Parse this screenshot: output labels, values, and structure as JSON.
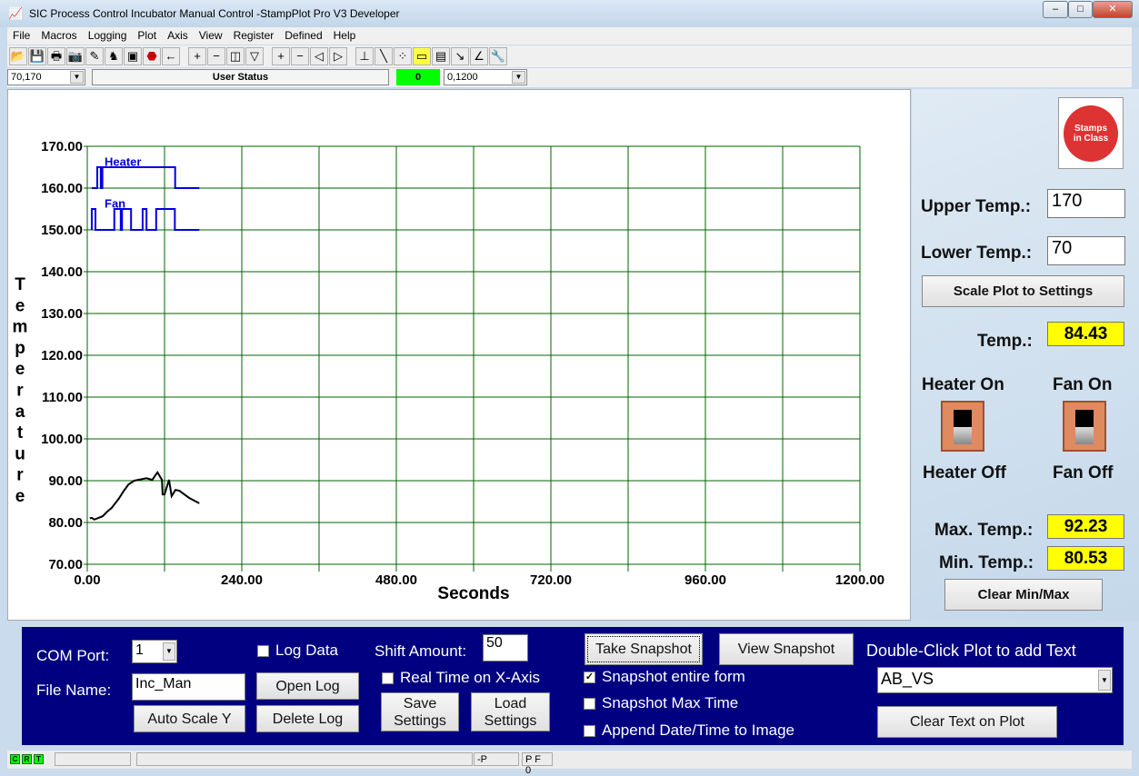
{
  "window": {
    "title": "SIC Process Control Incubator Manual Control -StampPlot Pro V3 Developer",
    "buttons": [
      "–",
      "□",
      "✕"
    ]
  },
  "menu": [
    "File",
    "Macros",
    "Logging",
    "Plot",
    "Axis",
    "View",
    "Register",
    "Defined",
    "Help"
  ],
  "toolbar": [
    "open-folder",
    "save",
    "print",
    "camera",
    "wand",
    "plot-dog",
    "screen",
    "stop",
    "back-arrow",
    "|",
    "plus",
    "minus",
    "zoom-box",
    "zoom-v",
    "|",
    "plus",
    "minus",
    "shift-left",
    "shift-right",
    "|",
    "axis",
    "pen",
    "scatter",
    "note",
    "clipboard",
    "probe",
    "angle",
    "wrench"
  ],
  "statusrow": {
    "y_range": "70,170",
    "user_status": "User Status",
    "counter": "0",
    "x_range": "0,1200",
    "counter_color": "#00ff00"
  },
  "chart_data": {
    "type": "line",
    "xlabel": "Seconds",
    "ylabel": "Temperature",
    "xlim": [
      0,
      1200
    ],
    "ylim": [
      70,
      170
    ],
    "xticks": [
      "0.00",
      "240.00",
      "480.00",
      "720.00",
      "960.00",
      "1200.00"
    ],
    "yticks": [
      "70.00",
      "80.00",
      "90.00",
      "100.00",
      "110.00",
      "120.00",
      "130.00",
      "140.00",
      "150.00",
      "160.00",
      "170.00"
    ],
    "grid": true,
    "grid_color": "#006400",
    "series": [
      {
        "name": "Heater",
        "color": "#0000e0",
        "x": [
          7,
          15.5,
          15.5,
          21,
          21,
          23.5,
          23.5,
          27,
          27,
          136.5,
          136.5,
          174
        ],
        "y": [
          160,
          160,
          165,
          165,
          160,
          160,
          165,
          165,
          165,
          165,
          160,
          160
        ]
      },
      {
        "name": "Fan",
        "color": "#0000e0",
        "x": [
          7,
          7,
          12.7,
          12.7,
          42,
          42,
          52,
          52,
          54,
          54,
          59,
          59,
          68,
          68,
          86,
          86,
          92,
          92,
          107,
          107,
          136,
          136,
          174
        ],
        "y": [
          150,
          155,
          155,
          150,
          150,
          155,
          155,
          150,
          150,
          155,
          155,
          155,
          155,
          150,
          150,
          155,
          155,
          150,
          150,
          155,
          155,
          150,
          150
        ]
      },
      {
        "color": "#000000",
        "x": [
          4,
          7,
          11,
          24,
          31,
          38,
          49,
          56,
          64,
          73,
          92,
          101,
          109,
          116,
          117,
          120,
          127,
          131,
          137,
          143,
          158,
          174
        ],
        "y": [
          81,
          81.1,
          80.7,
          81.5,
          82.6,
          83.5,
          85.7,
          87.4,
          89.1,
          90,
          90.6,
          90.2,
          92,
          90.2,
          86.7,
          86.7,
          90.2,
          86.3,
          87.8,
          87.6,
          85.9,
          84.6
        ]
      }
    ]
  },
  "right": {
    "upper_label": "Upper Temp.:",
    "upper_value": "170",
    "lower_label": "Lower Temp.:",
    "lower_value": "70",
    "scale_button": "Scale Plot to Settings",
    "temp_label": "Temp.:",
    "temp_value": "84.43",
    "heater_on": "Heater On",
    "heater_off": "Heater Off",
    "fan_on": "Fan On",
    "fan_off": "Fan Off",
    "max_label": "Max. Temp.:",
    "max_value": "92.23",
    "min_label": "Min. Temp.:",
    "min_value": "80.53",
    "clear_button": "Clear Min/Max",
    "logo": "Stamps in Class"
  },
  "bottom": {
    "com_label": "COM Port:",
    "com_value": "1",
    "file_label": "File Name:",
    "file_value": "Inc_Man",
    "auto_scale": "Auto Scale Y",
    "log_data": "Log Data",
    "log_checked": false,
    "open_log": "Open Log",
    "delete_log": "Delete Log",
    "shift_label": "Shift Amount:",
    "shift_value": "50",
    "real_time": "Real Time on X-Axis",
    "real_time_checked": false,
    "save_settings": "Save Settings",
    "load_settings": "Load Settings",
    "take_snapshot": "Take Snapshot",
    "view_snapshot": "View Snapshot",
    "snap_entire": "Snapshot entire form",
    "snap_entire_checked": true,
    "snap_max": "Snapshot Max Time",
    "snap_max_checked": false,
    "append_date": "Append Date/Time to Image",
    "append_checked": false,
    "dbl_click": "Double-Click Plot to add Text",
    "text_value": "AB_VS",
    "clear_text": "Clear Text on Plot"
  },
  "statusbar": {
    "leds": [
      "C",
      "R",
      "T"
    ],
    "p1": "-P",
    "p2": "P F 0"
  }
}
